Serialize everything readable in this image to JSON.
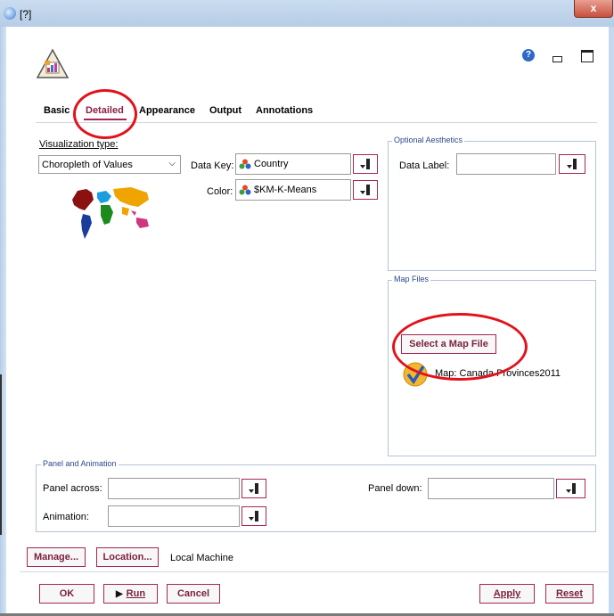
{
  "window": {
    "title": "[?]",
    "close_label": "x"
  },
  "tabs": [
    "Basic",
    "Detailed",
    "Appearance",
    "Output",
    "Annotations"
  ],
  "visualization": {
    "label": "Visualization type:",
    "selected": "Choropleth of Values"
  },
  "data_key": {
    "label": "Data Key:",
    "value": "Country"
  },
  "color": {
    "label": "Color:",
    "value": "$KM-K-Means"
  },
  "optional_aesthetics": {
    "title": "Optional Aesthetics",
    "data_label": "Data Label:",
    "data_label_value": ""
  },
  "map_files": {
    "title": "Map Files",
    "select_button": "Select a Map File",
    "map_entry": "Map: Canada Provinces2011"
  },
  "panel_animation": {
    "title": "Panel and Animation",
    "panel_across": "Panel across:",
    "panel_down": "Panel down:",
    "animation": "Animation:"
  },
  "manage": {
    "manage_button": "Manage...",
    "location_button": "Location...",
    "location_text": "Local Machine"
  },
  "footer": {
    "ok": "OK",
    "run": "Run",
    "cancel": "Cancel",
    "apply": "Apply",
    "reset": "Reset"
  },
  "colors": {
    "accent": "#a52655",
    "annotation_red": "#e2121b",
    "group_title": "#2a4a8a"
  },
  "icons": [
    "app-icon",
    "chart-builder-icon",
    "help-icon",
    "minimize-icon",
    "maximize-icon",
    "world-map-icon",
    "field-nominal-icon",
    "field-picker-icon",
    "map-check-icon",
    "run-triangle-icon"
  ]
}
